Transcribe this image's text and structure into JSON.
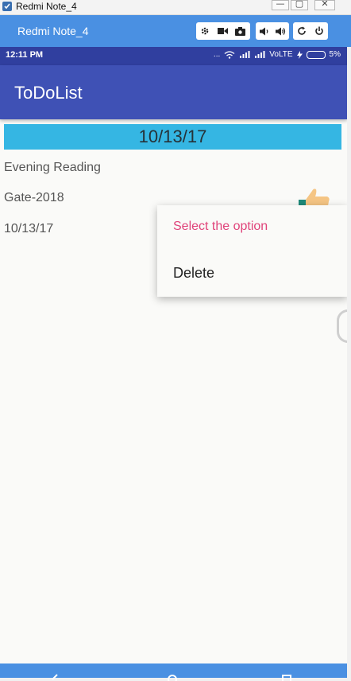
{
  "window": {
    "title": "Redmi Note_4",
    "min_symbol": "—",
    "max_symbol": "▢",
    "close_symbol": "✕"
  },
  "emulator_toolbar": {
    "device_name": "Redmi Note_4",
    "buttons": [
      "gear-icon",
      "video-icon",
      "camera-icon",
      "volume-down-icon",
      "volume-up-icon",
      "rotate-icon",
      "power-icon"
    ]
  },
  "status_bar": {
    "time": "12:11 PM",
    "dots": "...",
    "network": "VoLTE",
    "battery": "5%"
  },
  "app_bar": {
    "title": "ToDoList"
  },
  "list": {
    "date_header": "10/13/17",
    "items": [
      {
        "label": "Evening Reading"
      },
      {
        "label": "Gate-2018"
      },
      {
        "label": "10/13/17"
      }
    ]
  },
  "context_menu": {
    "title": "Select the option",
    "options": [
      "Delete"
    ]
  },
  "colors": {
    "app_bar": "#3f51b5",
    "status_bar": "#303f9f",
    "date_header": "#35b6e3",
    "menu_title": "#e0437a",
    "emulator_bar": "#4a90e2"
  }
}
